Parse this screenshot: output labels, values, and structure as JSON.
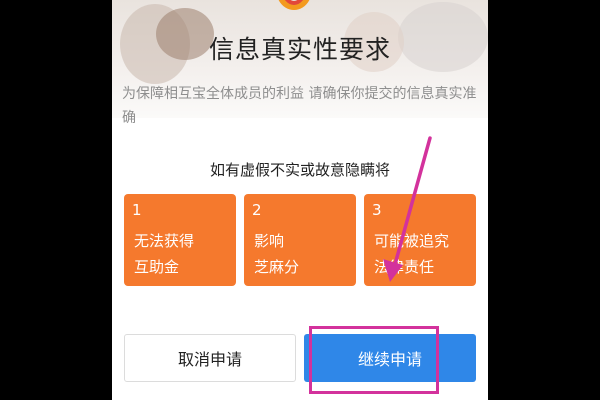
{
  "dialog": {
    "title": "信息真实性要求",
    "description": "为保障相互宝全体成员的利益 请确保你提交的信息真实准确",
    "warning": "如有虚假不实或故意隐瞒将"
  },
  "consequences": [
    {
      "num": "1",
      "text": "无法获得\n互助金"
    },
    {
      "num": "2",
      "text": "影响\n芝麻分"
    },
    {
      "num": "3",
      "text": "可能被追究\n法律责任"
    }
  ],
  "buttons": {
    "cancel_label": "取消申请",
    "continue_label": "继续申请"
  },
  "colors": {
    "card_orange": "#f5792d",
    "button_blue": "#2f87e8",
    "annotation_magenta": "#d3329c"
  },
  "icons": {
    "logo": "xianghubao-logo-icon",
    "annotation_arrow": "arrow-icon"
  }
}
